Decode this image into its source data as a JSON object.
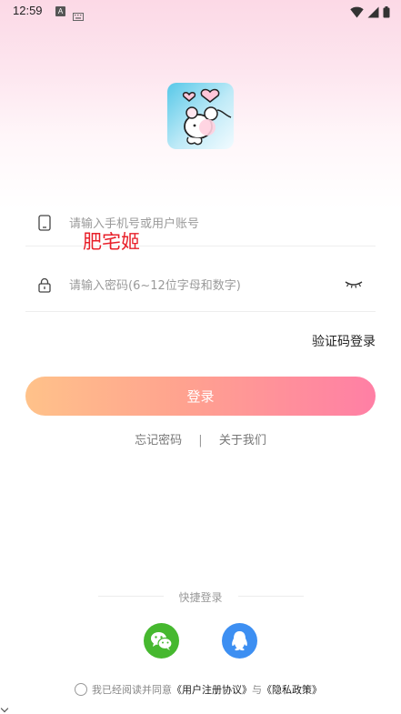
{
  "status_bar": {
    "time": "12:59",
    "a_icon_label": "A"
  },
  "app": {
    "logo_icon": "bear-hearts-logo"
  },
  "phone_field": {
    "placeholder": "请输入手机号或用户账号",
    "value": "",
    "icon": "phone-icon"
  },
  "overlay_text": "肥宅姬",
  "password_field": {
    "placeholder": "请输入密码(6~12位字母和数字)",
    "value": "",
    "icon": "lock-icon",
    "toggle_icon": "eye-closed-icon"
  },
  "sms_login_label": "验证码登录",
  "login_button_label": "登录",
  "links": {
    "forgot": "忘记密码",
    "separator": "|",
    "about": "关于我们"
  },
  "quick_login": {
    "label": "快捷登录",
    "wechat_icon": "wechat-icon",
    "qq_icon": "qq-icon"
  },
  "agreement": {
    "prefix": "我已经阅读并同意",
    "user_agreement": "《用户注册协议》",
    "connector": "与",
    "privacy_policy": "《隐私政策》",
    "checked": false
  },
  "colors": {
    "button_start": "#ffc28a",
    "button_end": "#ff7fa5",
    "overlay_red": "#e8202a",
    "wechat_green": "#46b82f",
    "qq_blue": "#3d8ff2"
  }
}
